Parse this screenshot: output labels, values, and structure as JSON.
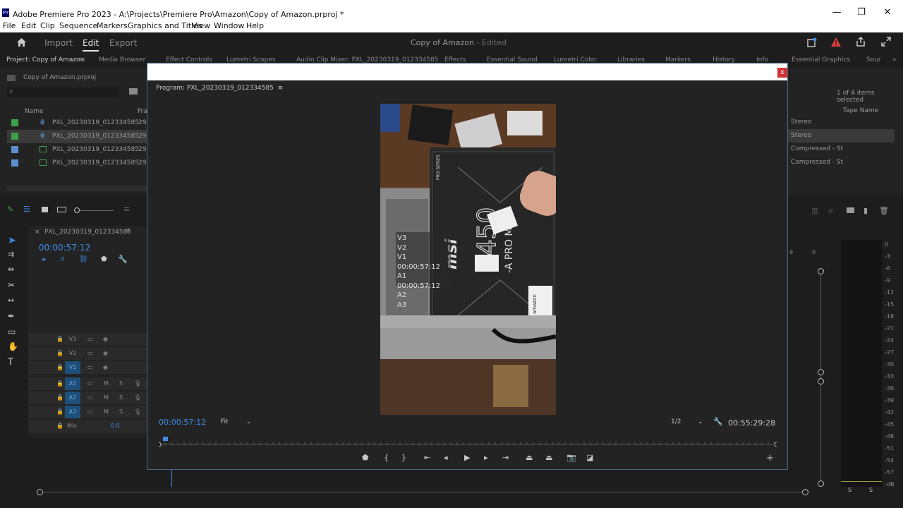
{
  "window": {
    "title": "Adobe Premiere Pro 2023 - A:\\Projects\\Premiere Pro\\Amazon\\Copy of Amazon.prproj *",
    "app_icon": "Pr",
    "minimize": "—",
    "restore": "❐",
    "close": "✕"
  },
  "menu": [
    "File",
    "Edit",
    "Clip",
    "Sequence",
    "Markers",
    "Graphics and Titles",
    "View",
    "Window",
    "Help"
  ],
  "header": {
    "workspaces": [
      "Import",
      "Edit",
      "Export"
    ],
    "doc_title": "Copy of Amazon",
    "doc_status": "- Edited"
  },
  "panel_tabs": [
    "Project: Copy of Amazon",
    "Media Browser",
    "Effect Controls",
    "Lumetri Scopes",
    "Audio Clip Mixer: PXL_20230319_012334585",
    "Effects",
    "Essential Sound",
    "Lumetri Color",
    "Libraries",
    "Markers",
    "History",
    "Info",
    "Essential Graphics",
    "Sour"
  ],
  "project": {
    "file": "Copy of Amazon.prproj",
    "col_name": "Name",
    "col_frame": "Fra",
    "items": [
      {
        "name": "PXL_20230319_012334585",
        "fr": "29.",
        "color": "#3fa04a"
      },
      {
        "name": "PXL_20230319_012334585",
        "fr": "29.",
        "color": "#3fa04a"
      },
      {
        "name": "PXL_20230319_012334585.",
        "fr": "29.",
        "color": "#5b8fd0"
      },
      {
        "name": "PXL_20230319_012334585.",
        "fr": "29.",
        "color": "#5b8fd0"
      }
    ]
  },
  "right_panel": {
    "selection": "1 of 4 items selected",
    "col_tape": "Tape Name",
    "rows": [
      "Stereo",
      "Stereo",
      "Compressed - St",
      "Compressed - St"
    ]
  },
  "timeline": {
    "sequence": "PXL_20230319_012334585",
    "timecode": "00:00:57:12",
    "tracks": [
      {
        "label": "V3",
        "on": false,
        "audio": false
      },
      {
        "label": "V2",
        "on": false,
        "audio": false
      },
      {
        "label": "V1",
        "on": true,
        "audio": false
      },
      {
        "label": "A1",
        "on": true,
        "audio": true
      },
      {
        "label": "A2",
        "on": true,
        "audio": true
      },
      {
        "label": "A3",
        "on": true,
        "audio": true
      }
    ],
    "mix_label": "Mix",
    "mix_value": "0.0",
    "m": "M",
    "s": "S"
  },
  "meter": {
    "scale": [
      "0",
      "-3",
      "-6",
      "-9",
      "-12",
      "-15",
      "-18",
      "-21",
      "-24",
      "-27",
      "-30",
      "-33",
      "-36",
      "-39",
      "-42",
      "-45",
      "-48",
      "-51",
      "-54",
      "-57",
      "-dB"
    ],
    "solo_left": "S",
    "solo_right": "S",
    "ruler_marks": [
      "9",
      "0"
    ]
  },
  "program": {
    "label": "Program: PXL_20230319_012334585",
    "overlay": [
      "V3",
      "V2",
      "V1 00:00:57:12",
      "A1 00:00:57:12",
      "A2",
      "A3"
    ],
    "timecode": "00:00:57:12",
    "fit": "Fit",
    "resolution": "1/2",
    "duration": "00:55:29:28",
    "close": "x",
    "product_text": {
      "brand": "msi",
      "model": "B450",
      "variant": "-A PRO MAX",
      "series": "PRO SERIES",
      "store": "amazon"
    }
  },
  "colors": {
    "accent": "#3f8ce8",
    "error": "#e03c3c",
    "label_green": "#3fa04a",
    "label_blue": "#5b8fd0"
  }
}
